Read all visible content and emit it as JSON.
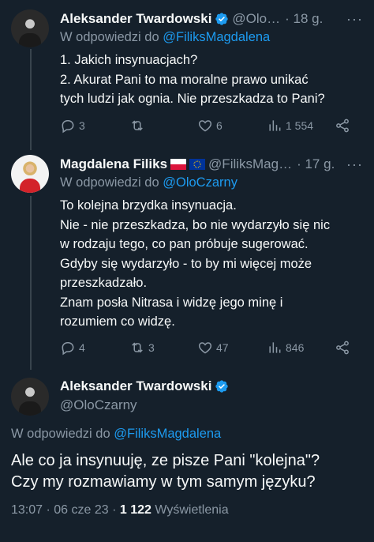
{
  "tweets": [
    {
      "name": "Aleksander Twardowski",
      "handle": "@Olo…",
      "time": "· 18 g.",
      "more": "···",
      "reply_prefix": "W odpowiedzi do",
      "reply_to": "@FiliksMagdalena",
      "lines": [
        "1. Jakich insynuacjach?",
        "2. Akurat Pani to ma moralne prawo unikać",
        "tych ludzi jak ognia. Nie przeszkadza to Pani?"
      ],
      "stats": {
        "replies": "3",
        "retweets": "",
        "likes": "6",
        "views": "1 554"
      }
    },
    {
      "name": "Magdalena Filiks",
      "handle": "@FiliksMag…",
      "time": "· 17 g.",
      "more": "···",
      "reply_prefix": "W odpowiedzi do",
      "reply_to": "@OloCzarny",
      "lines": [
        "To kolejna brzydka insynuacja.",
        "Nie - nie przeszkadza, bo nie wydarzyło  się nic",
        "w rodzaju tego, co pan próbuje sugerować.",
        "Gdyby się wydarzyło - to by mi więcej może",
        "przeszkadzało.",
        "Znam posła Nitrasa i widzę jego minę i",
        "rozumiem co widzę."
      ],
      "stats": {
        "replies": "4",
        "retweets": "3",
        "likes": "47",
        "views": "846"
      }
    }
  ],
  "main": {
    "name": "Aleksander Twardowski",
    "handle": "@OloCzarny",
    "reply_prefix": "W odpowiedzi do",
    "reply_to": "@FiliksMagdalena",
    "lines": [
      "Ale co ja insynuuję, ze pisze Pani \"kolejna\"?",
      "Czy my rozmawiamy w tym samym języku?"
    ],
    "datetime": "13:07 · 06 cze 23 ·",
    "views_count": "1 122",
    "views_label": "Wyświetlenia"
  },
  "colors": {
    "background": "#15202b",
    "text": "#f7f9f9",
    "secondary": "#8b98a5",
    "link": "#1d9bf0",
    "verified": "#1d9bf0"
  },
  "icons": [
    "verified-badge-icon",
    "reply-icon",
    "retweet-icon",
    "like-icon",
    "views-icon",
    "share-icon",
    "poland-flag-icon",
    "eu-flag-icon"
  ]
}
